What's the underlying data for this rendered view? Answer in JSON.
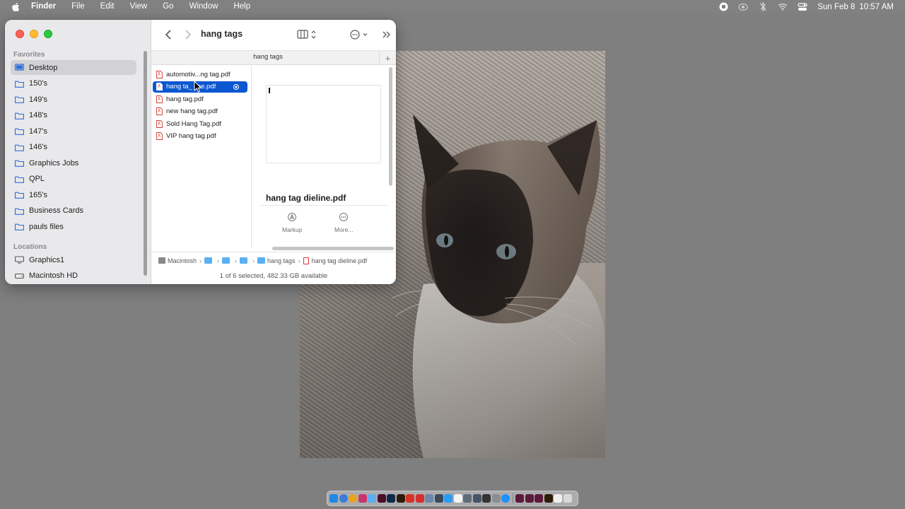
{
  "menubar": {
    "app_name": "Finder",
    "menus": [
      "File",
      "Edit",
      "View",
      "Go",
      "Window",
      "Help"
    ],
    "clock_date": "Sun Feb 8",
    "clock_time": "10:57 AM",
    "status_icons": [
      "stop-recording-icon",
      "focus-icon",
      "bluetooth-icon",
      "wifi-icon",
      "control-center-icon"
    ]
  },
  "sidebar": {
    "favorites_label": "Favorites",
    "favorites": [
      {
        "label": "Desktop",
        "icon": "desktop-icon",
        "selected": true
      },
      {
        "label": "150's",
        "icon": "folder-icon"
      },
      {
        "label": "149's",
        "icon": "folder-icon"
      },
      {
        "label": "148's",
        "icon": "folder-icon"
      },
      {
        "label": "147's",
        "icon": "folder-icon"
      },
      {
        "label": "146's",
        "icon": "folder-icon"
      },
      {
        "label": "Graphics Jobs",
        "icon": "folder-icon"
      },
      {
        "label": "QPL",
        "icon": "folder-icon"
      },
      {
        "label": "165's",
        "icon": "folder-icon"
      },
      {
        "label": "Business Cards",
        "icon": "folder-icon"
      },
      {
        "label": "pauls files",
        "icon": "folder-icon"
      }
    ],
    "locations_label": "Locations",
    "locations": [
      {
        "label": "Graphics1",
        "icon": "display-icon"
      },
      {
        "label": "Macintosh HD",
        "icon": "hard-drive-icon"
      }
    ]
  },
  "toolbar": {
    "title": "hang tags"
  },
  "tab": {
    "title": "hang tags",
    "add_label": "+"
  },
  "files": [
    {
      "name": "automotiv...ng tag.pdf"
    },
    {
      "name": "hang tag dieline.pdf",
      "display": "hang ta_ line.pdf",
      "selected": true
    },
    {
      "name": "hang tag.pdf"
    },
    {
      "name": "new hang tag.pdf"
    },
    {
      "name": "Sold Hang Tag.pdf"
    },
    {
      "name": "VIP hang tag.pdf"
    }
  ],
  "preview": {
    "file_name": "hang tag dieline.pdf",
    "actions": [
      {
        "label": "Markup",
        "icon": "markup-icon"
      },
      {
        "label": "More...",
        "icon": "more-icon"
      }
    ]
  },
  "pathbar": {
    "items": [
      "Macintosh",
      "",
      "",
      "",
      "hang tags",
      "hang tag dieline.pdf"
    ]
  },
  "status": {
    "text": "1 of 6 selected, 482.33 GB available"
  },
  "colors": {
    "selection": "#0b57d0",
    "desktop": "#7f7f80",
    "close": "#fe5f57",
    "minimize": "#febc2e",
    "zoom": "#28c840"
  }
}
